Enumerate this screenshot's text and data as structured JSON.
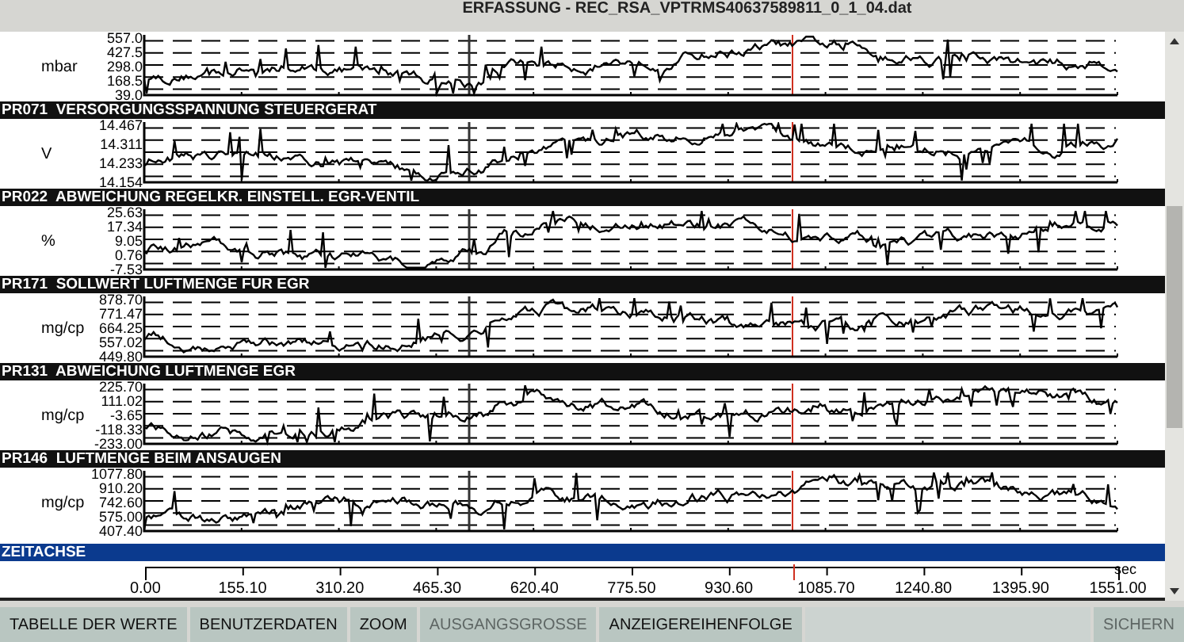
{
  "window": {
    "title": "ERFASSUNG - REC_RSA_VPTRMS40637589811_0_1_04.dat"
  },
  "channels": [
    {
      "unit": "mbar",
      "ticks": [
        "557.0",
        "427.5",
        "298.0",
        "168.5",
        "39.0"
      ]
    },
    {
      "code": "PR071",
      "name": "VERSORGUNGSSPANNUNG STEUERGERAT",
      "unit": "V",
      "ticks": [
        "14.467",
        "14.311",
        "14.233",
        "14.154"
      ]
    },
    {
      "code": "PR022",
      "name": "ABWEICHUNG REGELKR. EINSTELL. EGR-VENTIL",
      "unit": "%",
      "ticks": [
        "25.63",
        "17.34",
        "9.05",
        "0.76",
        "-7.53"
      ]
    },
    {
      "code": "PR171",
      "name": "SOLLWERT LUFTMENGE FUR EGR",
      "unit": "mg/cp",
      "ticks": [
        "878.70",
        "771.47",
        "664.25",
        "557.02",
        "449.80"
      ]
    },
    {
      "code": "PR131",
      "name": "ABWEICHUNG LUFTMENGE EGR",
      "unit": "mg/cp",
      "ticks": [
        "225.70",
        "111.02",
        "-3.65",
        "-118.33",
        "-233.00"
      ]
    },
    {
      "code": "PR146",
      "name": "LUFTMENGE BEIM ANSAUGEN",
      "unit": "mg/cp",
      "ticks": [
        "1077.80",
        "910.20",
        "742.60",
        "575.00",
        "407.40"
      ]
    }
  ],
  "time_axis": {
    "title": "ZEITACHSE",
    "unit": "sec",
    "labels": [
      "0.00",
      "155.10",
      "310.20",
      "465.30",
      "620.40",
      "775.50",
      "930.60",
      "1085.70",
      "1240.80",
      "1395.90",
      "1551.00"
    ]
  },
  "buttons": [
    {
      "label": "TABELLE DER WERTE",
      "disabled": false
    },
    {
      "label": "BENUTZERDATEN",
      "disabled": false
    },
    {
      "label": "ZOOM",
      "disabled": false
    },
    {
      "label": "AUSGANGSGROSSE",
      "disabled": true
    },
    {
      "label": "ANZEIGEREIHENFOLGE",
      "disabled": false
    }
  ],
  "save_button": {
    "label": "SICHERN",
    "disabled": true
  }
}
